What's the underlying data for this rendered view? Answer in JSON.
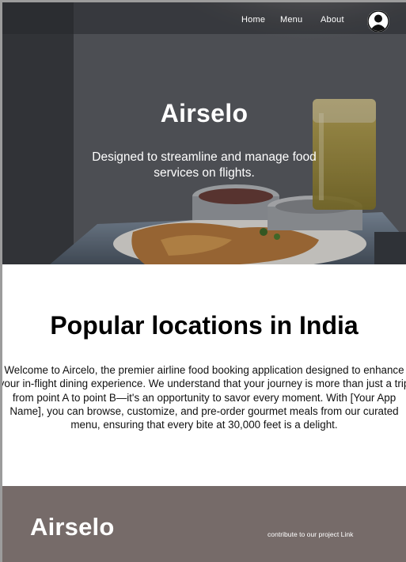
{
  "nav": {
    "home_label": "Home",
    "menu_label": "Menu",
    "about_label": "About",
    "avatar_icon": "user-icon"
  },
  "hero": {
    "title": "Airselo",
    "subtitle": "Designed to streamline and manage food services on flights."
  },
  "locations": {
    "title": "Popular locations in India",
    "body": "Welcome to Aircelo, the premier airline food booking application designed to enhance your in-flight dining experience. We understand that your journey is more than just a trip from point A to point B—it's an opportunity to savor every moment. With [Your App Name], you can browse, customize, and pre-order gourmet meals from our curated menu, ensuring that every bite at 30,000 feet is a delight."
  },
  "footer": {
    "logo": "Airselo",
    "link_label": "contribute to our project Link"
  },
  "colors": {
    "footer_bg": "#766b69",
    "hero_text": "#ffffff"
  }
}
